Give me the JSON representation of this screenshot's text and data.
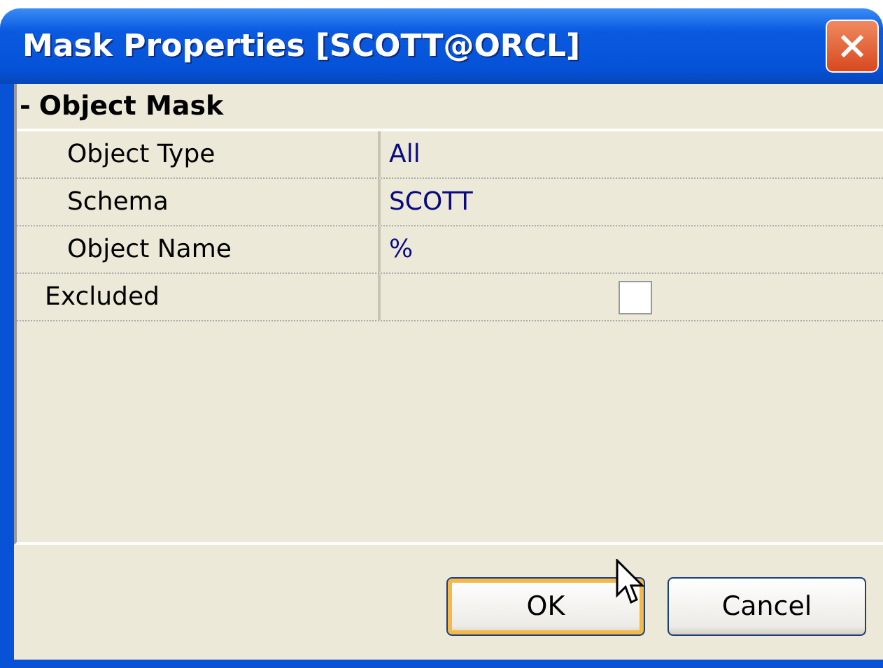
{
  "window": {
    "title": "Mask Properties [SCOTT@ORCL]"
  },
  "category": {
    "label": "Object Mask",
    "toggle": "-",
    "expanded": true
  },
  "properties": [
    {
      "kind": "text",
      "label": "Object Type",
      "value": "All"
    },
    {
      "kind": "text",
      "label": "Schema",
      "value": "SCOTT"
    },
    {
      "kind": "text",
      "label": "Object Name",
      "value": "%"
    }
  ],
  "extra": [
    {
      "kind": "checkbox",
      "label": "Excluded",
      "checked": false
    }
  ],
  "buttons": [
    {
      "label": "OK",
      "default": true
    },
    {
      "label": "Cancel",
      "default": false
    }
  ]
}
